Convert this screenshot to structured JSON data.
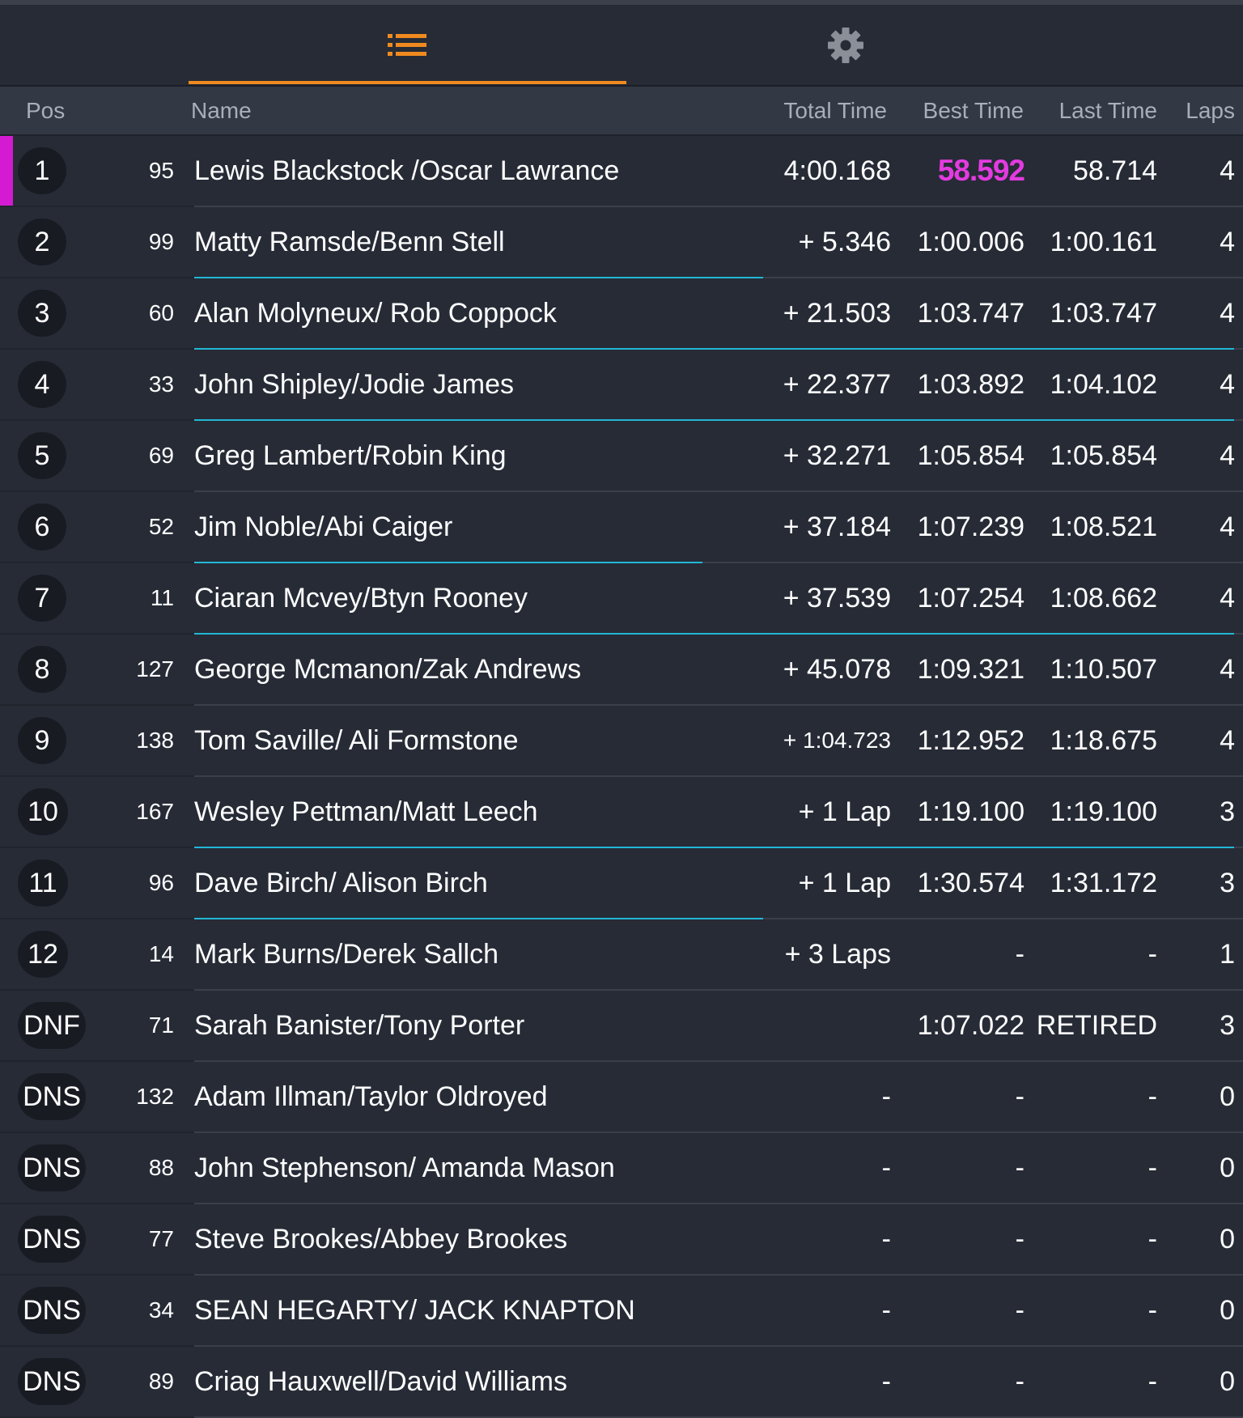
{
  "tabs": [
    {
      "label": "",
      "icon": "list-icon",
      "active": true
    },
    {
      "label": "",
      "icon": "gear-icon",
      "active": false
    }
  ],
  "colors": {
    "background": "#262b36",
    "header": "#323844",
    "accent": "#f08a1f",
    "fastest": "#e33be0",
    "position_changed": "#22b7d5"
  },
  "columns": {
    "pos": "Pos",
    "name": "Name",
    "total": "Total Time",
    "best": "Best Time",
    "last": "Last Time",
    "laps": "Laps"
  },
  "rows": [
    {
      "pos": "1",
      "car": "95",
      "name": "Lewis Blackstock /Oscar Lawrance",
      "total": "4:00.168",
      "best": "58.592",
      "last": "58.714",
      "laps": "4"
    },
    {
      "pos": "2",
      "car": "99",
      "name": "Matty Ramsde/Benn Stell",
      "total": "+ 5.346",
      "best": "1:00.006",
      "last": "1:00.161",
      "laps": "4"
    },
    {
      "pos": "3",
      "car": "60",
      "name": "Alan Molyneux/ Rob Coppock",
      "total": "+ 21.503",
      "best": "1:03.747",
      "last": "1:03.747",
      "laps": "4"
    },
    {
      "pos": "4",
      "car": "33",
      "name": "John Shipley/Jodie James",
      "total": "+ 22.377",
      "best": "1:03.892",
      "last": "1:04.102",
      "laps": "4"
    },
    {
      "pos": "5",
      "car": "69",
      "name": "Greg Lambert/Robin King",
      "total": "+ 32.271",
      "best": "1:05.854",
      "last": "1:05.854",
      "laps": "4"
    },
    {
      "pos": "6",
      "car": "52",
      "name": "Jim Noble/Abi Caiger",
      "total": "+ 37.184",
      "best": "1:07.239",
      "last": "1:08.521",
      "laps": "4"
    },
    {
      "pos": "7",
      "car": "11",
      "name": "Ciaran Mcvey/Btyn Rooney",
      "total": "+ 37.539",
      "best": "1:07.254",
      "last": "1:08.662",
      "laps": "4"
    },
    {
      "pos": "8",
      "car": "127",
      "name": "George Mcmanon/Zak Andrews",
      "total": "+ 45.078",
      "best": "1:09.321",
      "last": "1:10.507",
      "laps": "4"
    },
    {
      "pos": "9",
      "car": "138",
      "name": "Tom Saville/ Ali Formstone",
      "total": "+ 1:04.723",
      "best": "1:12.952",
      "last": "1:18.675",
      "laps": "4"
    },
    {
      "pos": "10",
      "car": "167",
      "name": "Wesley Pettman/Matt Leech",
      "total": "+ 1 Lap",
      "best": "1:19.100",
      "last": "1:19.100",
      "laps": "3"
    },
    {
      "pos": "11",
      "car": "96",
      "name": "Dave Birch/ Alison Birch",
      "total": "+ 1 Lap",
      "best": "1:30.574",
      "last": "1:31.172",
      "laps": "3"
    },
    {
      "pos": "12",
      "car": "14",
      "name": "Mark Burns/Derek Sallch",
      "total": "+ 3 Laps",
      "best": "-",
      "last": "-",
      "laps": "1"
    },
    {
      "pos": "DNF",
      "car": "71",
      "name": "Sarah Banister/Tony Porter",
      "total": "",
      "best": "1:07.022",
      "last": "RETIRED",
      "laps": "3"
    },
    {
      "pos": "DNS",
      "car": "132",
      "name": "Adam Illman/Taylor Oldroyed",
      "total": "-",
      "best": "-",
      "last": "-",
      "laps": "0"
    },
    {
      "pos": "DNS",
      "car": "88",
      "name": "John Stephenson/ Amanda Mason",
      "total": "-",
      "best": "-",
      "last": "-",
      "laps": "0"
    },
    {
      "pos": "DNS",
      "car": "77",
      "name": "Steve Brookes/Abbey Brookes",
      "total": "-",
      "best": "-",
      "last": "-",
      "laps": "0"
    },
    {
      "pos": "DNS",
      "car": "34",
      "name": "SEAN HEGARTY/ JACK KNAPTON",
      "total": "-",
      "best": "-",
      "last": "-",
      "laps": "0"
    },
    {
      "pos": "DNS",
      "car": "89",
      "name": "Criag Hauxwell/David Williams",
      "total": "-",
      "best": "-",
      "last": "-",
      "laps": "0"
    }
  ]
}
